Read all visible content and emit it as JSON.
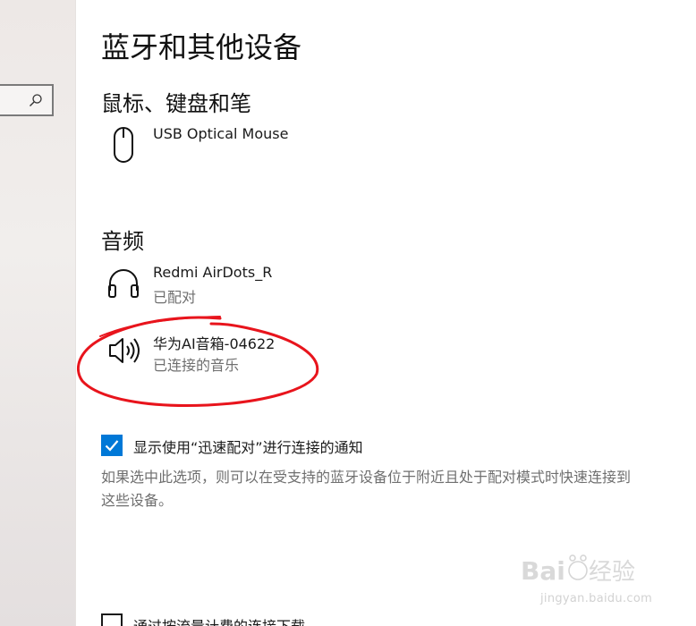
{
  "search": {
    "icon": "search-icon"
  },
  "page": {
    "title": "蓝牙和其他设备"
  },
  "sections": {
    "input": {
      "heading": "鼠标、键盘和笔",
      "devices": [
        {
          "name": "USB Optical Mouse",
          "status": "",
          "icon": "mouse-icon"
        }
      ]
    },
    "audio": {
      "heading": "音频",
      "devices": [
        {
          "name": "Redmi AirDots_R",
          "status": "已配对",
          "icon": "headphones-icon"
        },
        {
          "name": "华为AI音箱-04622",
          "status": "已连接的音乐",
          "icon": "speaker-icon"
        }
      ]
    }
  },
  "swift_pair": {
    "checked": true,
    "label": "显示使用“迅速配对”进行连接的通知",
    "description": "如果选中此选项，则可以在受支持的蓝牙设备位于附近且处于配对模式时快速连接到这些设备。"
  },
  "metered": {
    "checked": false,
    "label": "通过按流量计费的连接下载"
  },
  "colors": {
    "accent": "#0078d7",
    "annotation": "#e8141c",
    "secondary_text": "#6f6f6f"
  },
  "watermark": {
    "text": "jingyan.baidu.com"
  }
}
